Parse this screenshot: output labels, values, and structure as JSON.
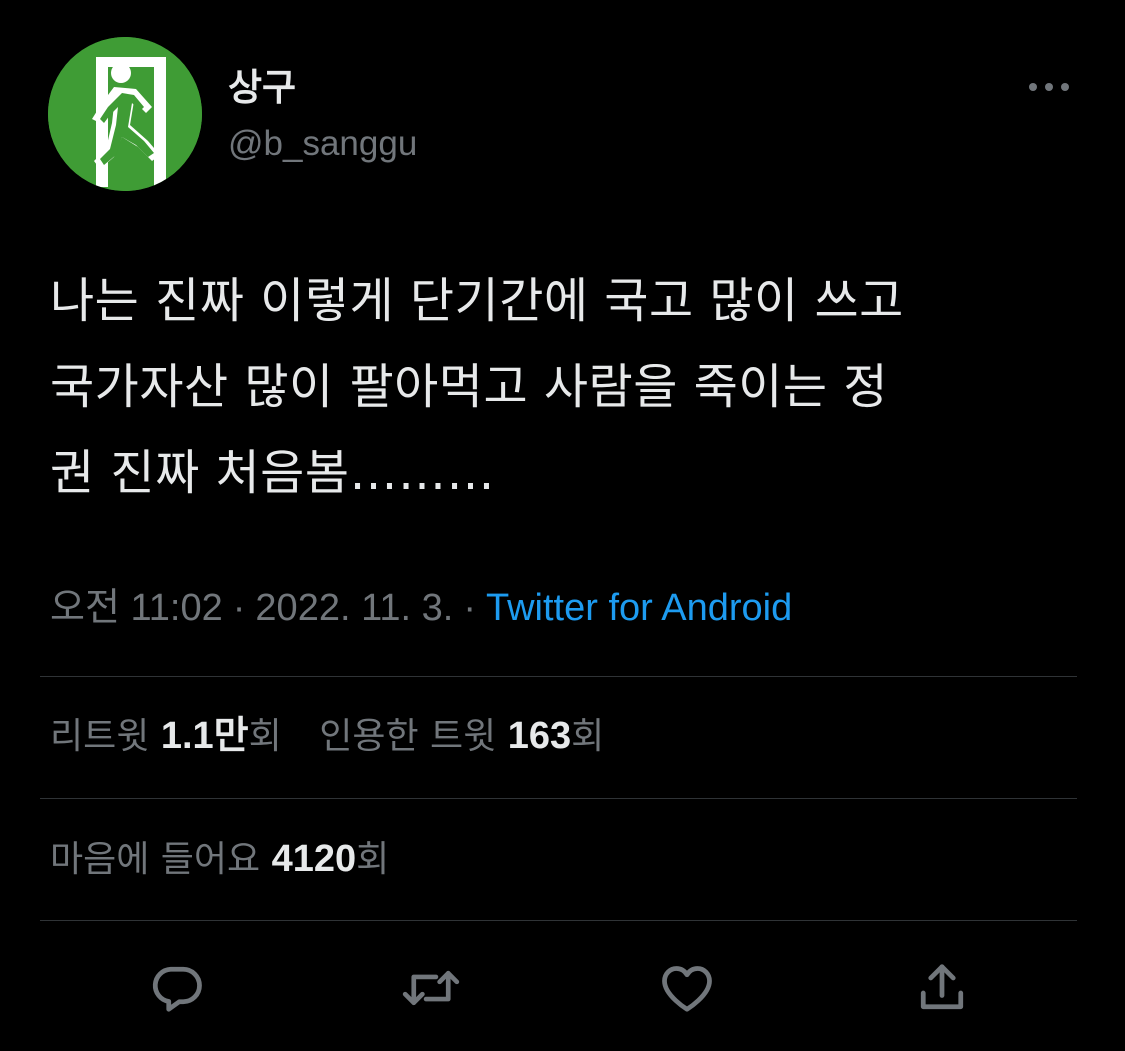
{
  "tweet": {
    "author": {
      "display_name": "상구",
      "handle": "@b_sanggu",
      "avatar_icon": "emergency-exit-icon",
      "avatar_color": "#3f9c35"
    },
    "more_icon": "more-horizontal-icon",
    "text_lines": [
      "나는 진짜 이렇게 단기간에 국고 많이 쓰고",
      "국가자산 많이 팔아먹고 사람을 죽이는 정",
      "권 진짜 처음봄………"
    ],
    "meta": {
      "time": "오전 11:02",
      "date": "2022. 11. 3.",
      "separator": "·",
      "source": "Twitter for Android"
    },
    "stats": {
      "retweets_label": "리트윗",
      "retweets_count": "1.1만",
      "retweets_suffix": "회",
      "quotes_label": "인용한 트윗",
      "quotes_count": "163",
      "quotes_suffix": "회",
      "likes_label": "마음에 들어요",
      "likes_count": "4120",
      "likes_suffix": "회"
    },
    "actions": {
      "reply_icon": "reply-icon",
      "retweet_icon": "retweet-icon",
      "like_icon": "heart-icon",
      "share_icon": "share-icon"
    }
  },
  "colors": {
    "background": "#000000",
    "text_primary": "#e7e9ea",
    "text_secondary": "#71767b",
    "link": "#1d9bf0",
    "divider": "#2f3336"
  }
}
